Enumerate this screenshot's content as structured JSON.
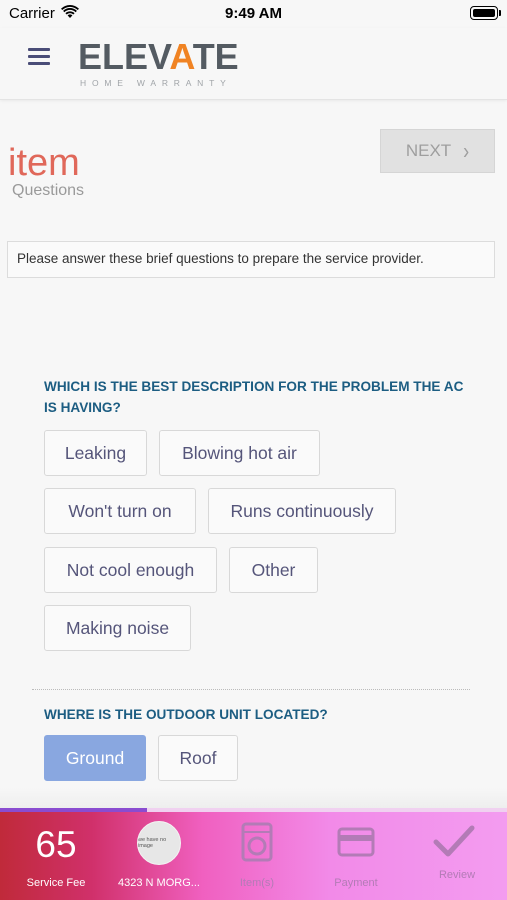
{
  "status_bar": {
    "carrier": "Carrier",
    "time": "9:49 AM"
  },
  "header": {
    "logo_text_before": "ELEV",
    "logo_text_accent": "A",
    "logo_text_after": "TE",
    "logo_subtitle": "HOME WARRANTY"
  },
  "page": {
    "title": "item",
    "subtitle": "Questions",
    "next_label": "NEXT",
    "instructions": "Please answer these brief questions to prepare the service provider."
  },
  "questions": [
    {
      "text": "WHICH IS THE BEST DESCRIPTION FOR THE PROBLEM THE AC IS HAVING?",
      "options": [
        "Leaking",
        "Blowing hot air",
        "Won't turn on",
        "Runs continuously",
        "Not cool enough",
        "Other",
        "Making noise"
      ],
      "selected": null
    },
    {
      "text": "WHERE IS THE OUTDOOR UNIT LOCATED?",
      "options": [
        "Ground",
        "Roof"
      ],
      "selected": "Ground"
    }
  ],
  "progress": {
    "fraction": 0.29
  },
  "tabbar": {
    "fee_value": "65",
    "fee_label": "Service Fee",
    "avatar_text": "we have no image",
    "address_label": "4323 N MORG...",
    "items_label": "Item(s)",
    "payment_label": "Payment",
    "review_label": "Review"
  },
  "colors": {
    "title": "#e0685a",
    "question": "#1c5d82",
    "selected_option": "#89a7e0",
    "logo_accent": "#f08323"
  },
  "icons": [
    "wifi-icon",
    "battery-icon",
    "hamburger-menu-icon",
    "chevron-right-icon",
    "washer-icon",
    "credit-card-icon",
    "checkmark-icon"
  ]
}
